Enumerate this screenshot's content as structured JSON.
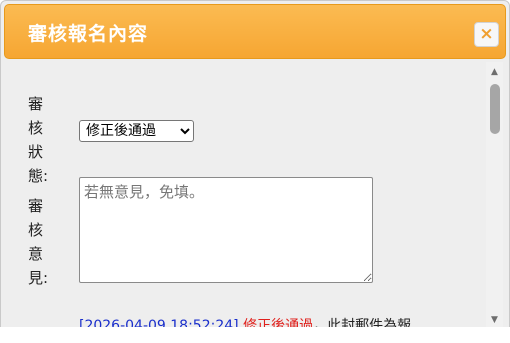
{
  "dialog": {
    "title": "審核報名內容",
    "close_label": "×"
  },
  "form": {
    "status_label": "審核狀態:",
    "status_selected": "修正後通過",
    "opinion_label": "審核意見:",
    "opinion_placeholder": "若無意見，免填。"
  },
  "log": {
    "time": "[2026-04-09 18:52:24]",
    "status": "修正後通過",
    "message": "，此封郵件為報"
  },
  "icons": {
    "close": "close-icon",
    "scroll_up": "arrow-up-icon",
    "scroll_down": "arrow-down-icon"
  },
  "colors": {
    "titlebar": "#f6a632",
    "log_time": "#1a2fcc",
    "log_status": "#e0201c"
  }
}
